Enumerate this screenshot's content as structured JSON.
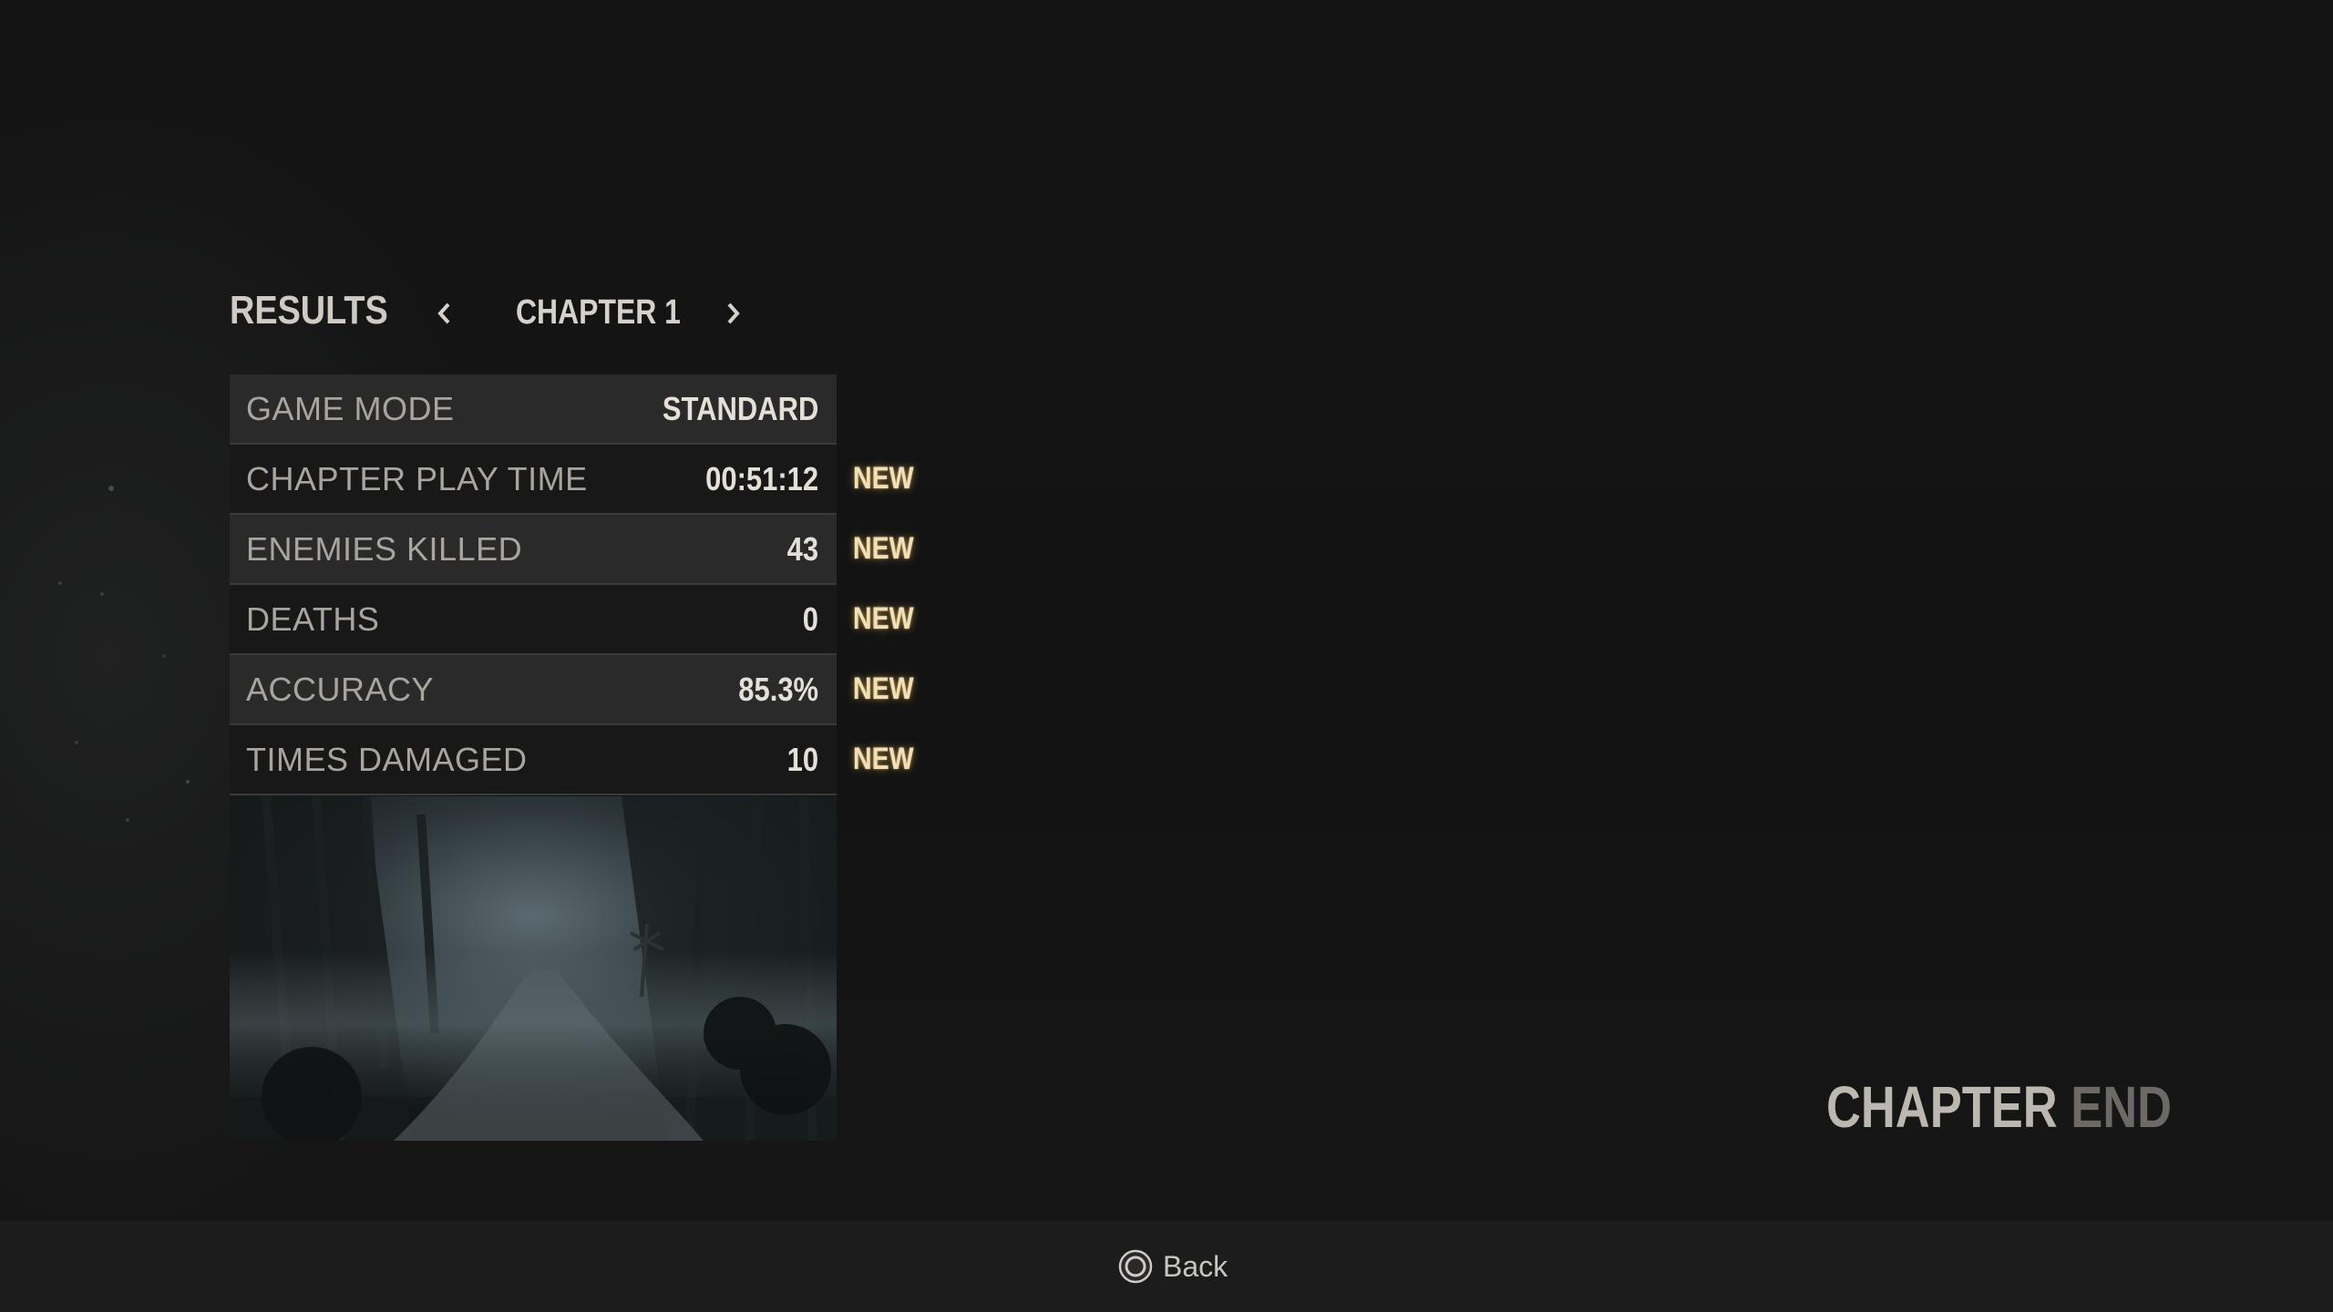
{
  "header": {
    "title": "RESULTS",
    "chapter": "CHAPTER 1"
  },
  "stats": [
    {
      "label": "GAME MODE",
      "value": "STANDARD",
      "badge": ""
    },
    {
      "label": "CHAPTER PLAY TIME",
      "value": "00:51:12",
      "badge": "NEW"
    },
    {
      "label": "ENEMIES KILLED",
      "value": "43",
      "badge": "NEW"
    },
    {
      "label": "DEATHS",
      "value": "0",
      "badge": "NEW"
    },
    {
      "label": "ACCURACY",
      "value": "85.3%",
      "badge": "NEW"
    },
    {
      "label": "TIMES DAMAGED",
      "value": "10",
      "badge": "NEW"
    }
  ],
  "chapter_end": {
    "word1": "CHAPTER",
    "word2": "END"
  },
  "footer": {
    "back_label": "Back",
    "back_icon": "circle-button-icon"
  },
  "colors": {
    "background": "#121212",
    "row_shaded": "#2a2a2a",
    "new_badge": "#f1dfb6"
  }
}
